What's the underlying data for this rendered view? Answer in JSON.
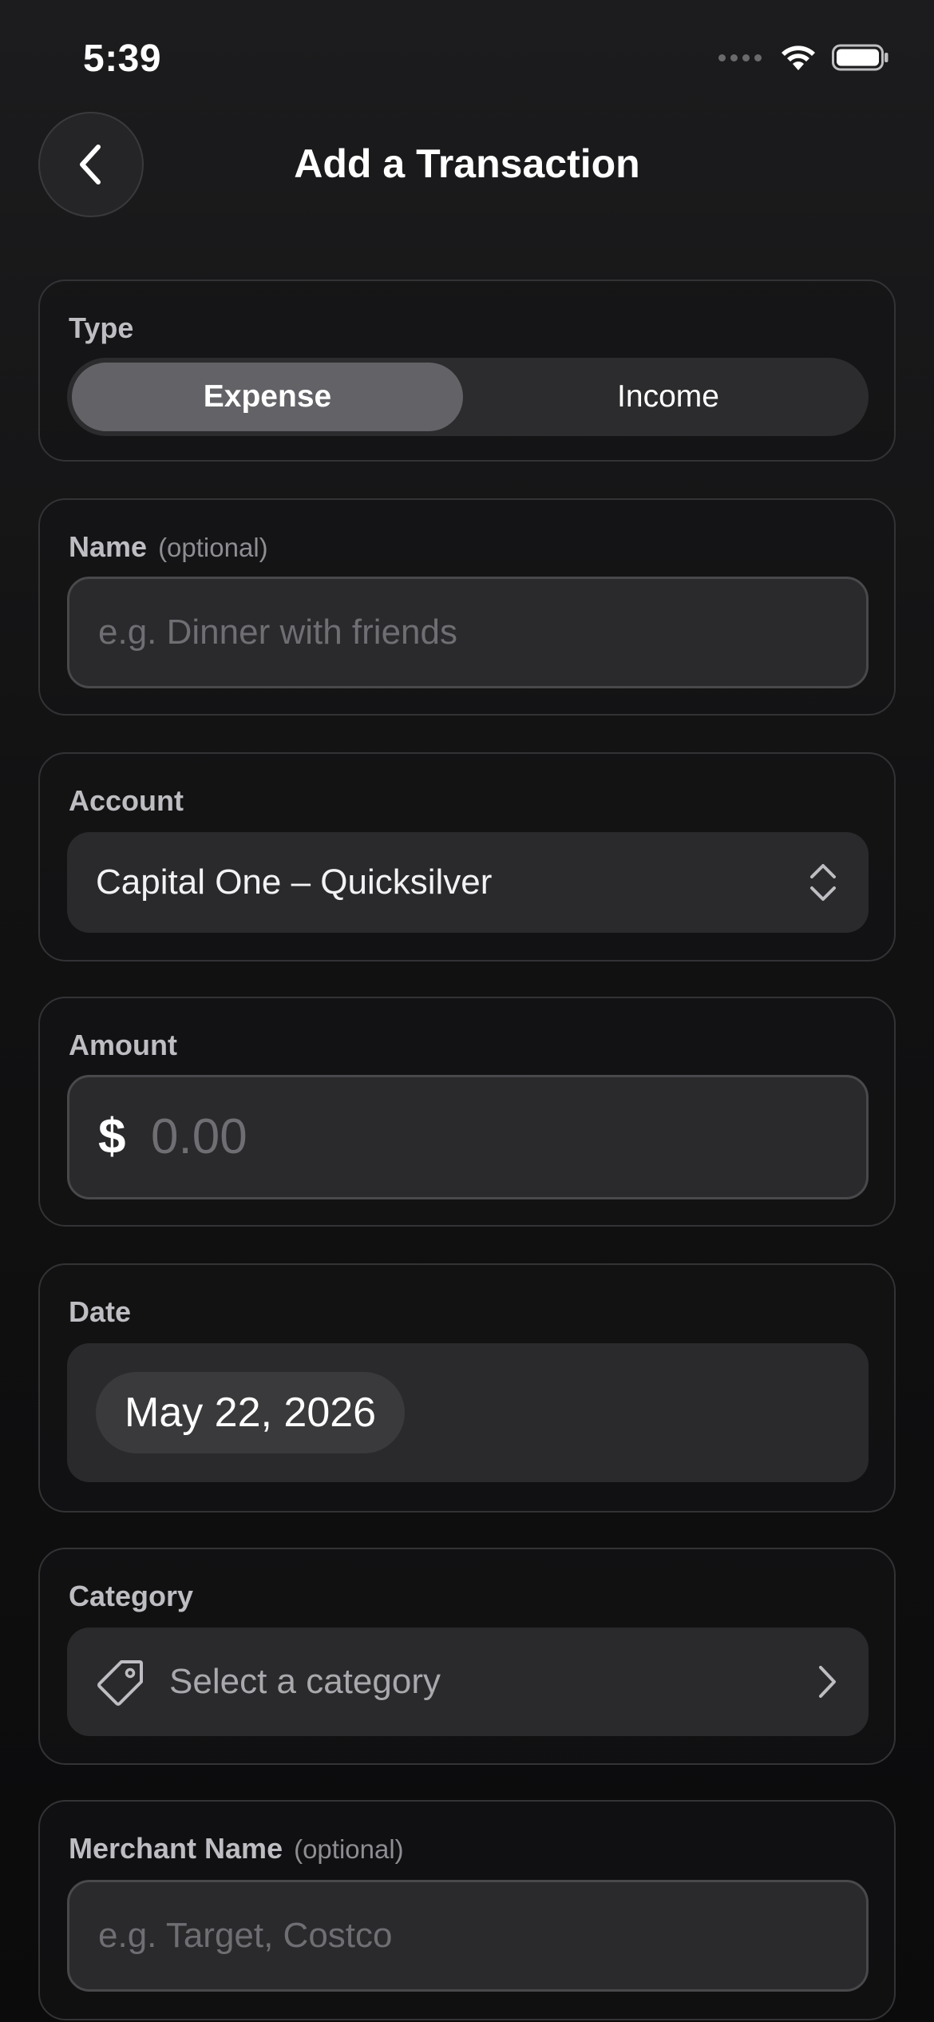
{
  "status_bar": {
    "time": "5:39"
  },
  "header": {
    "title": "Add a Transaction"
  },
  "type_section": {
    "label": "Type",
    "options": [
      "Expense",
      "Income"
    ],
    "selected": "Expense"
  },
  "name_section": {
    "label": "Name",
    "optional_note": "(optional)",
    "placeholder": "e.g. Dinner with friends"
  },
  "account_section": {
    "label": "Account",
    "value": "Capital One – Quicksilver"
  },
  "amount_section": {
    "label": "Amount",
    "currency_symbol": "$",
    "placeholder": "0.00"
  },
  "date_section": {
    "label": "Date",
    "value": "May 22, 2026"
  },
  "category_section": {
    "label": "Category",
    "placeholder": "Select a category",
    "icon": "tag-icon"
  },
  "merchant_section": {
    "label": "Merchant Name",
    "optional_note": "(optional)",
    "placeholder": "e.g. Target, Costco"
  },
  "colors": {
    "background": "#121213",
    "card_border": "#333336",
    "field_bg": "#2a2a2c",
    "segment_active": "#636367",
    "placeholder": "#6e6e73"
  }
}
